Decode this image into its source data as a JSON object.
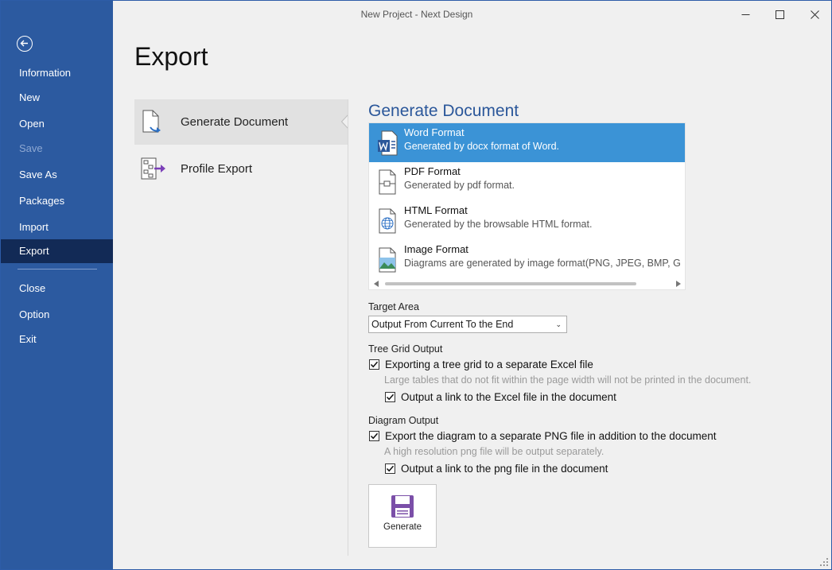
{
  "window": {
    "title": "New Project - Next Design",
    "controls": [
      "minimize-icon",
      "maximize-icon",
      "close-icon"
    ]
  },
  "sidebar": {
    "back_icon": "back-arrow-icon",
    "items": [
      {
        "label": "Information",
        "state": "normal"
      },
      {
        "label": "New",
        "state": "normal"
      },
      {
        "label": "Open",
        "state": "normal"
      },
      {
        "label": "Save",
        "state": "disabled"
      },
      {
        "label": "Save As",
        "state": "normal"
      },
      {
        "label": "Packages",
        "state": "normal"
      },
      {
        "label": "Import",
        "state": "normal"
      },
      {
        "label": "Export",
        "state": "active"
      },
      {
        "label": "Close",
        "state": "normal"
      },
      {
        "label": "Option",
        "state": "normal"
      },
      {
        "label": "Exit",
        "state": "normal"
      }
    ],
    "colors": {
      "background": "#2c5aa0",
      "active": "#122a56"
    }
  },
  "page": {
    "title": "Export"
  },
  "options": [
    {
      "label": "Generate Document",
      "icon": "document-export-icon",
      "selected": true
    },
    {
      "label": "Profile Export",
      "icon": "profile-export-icon",
      "selected": false
    }
  ],
  "panel": {
    "title": "Generate Document",
    "formats": [
      {
        "name": "Word Format",
        "desc": "Generated by docx format of Word.",
        "icon": "word-file-icon",
        "selected": true
      },
      {
        "name": "PDF Format",
        "desc": "Generated by pdf format.",
        "icon": "pdf-file-icon",
        "selected": false
      },
      {
        "name": "HTML Format",
        "desc": "Generated by the browsable HTML format.",
        "icon": "html-globe-icon",
        "selected": false
      },
      {
        "name": "Image Format",
        "desc": "Diagrams are generated by image format(PNG, JPEG, BMP, G",
        "icon": "image-file-icon",
        "selected": false
      }
    ],
    "target_area": {
      "label": "Target Area",
      "value": "Output From Current To the End"
    },
    "tree_grid": {
      "label": "Tree Grid Output",
      "export_label": "Exporting a tree grid to a separate Excel file",
      "export_checked": true,
      "hint": "Large tables that do not fit within the page width will not be printed in the document.",
      "link_label": "Output a link to the Excel file in the document",
      "link_checked": true
    },
    "diagram": {
      "label": "Diagram Output",
      "export_label": "Export the diagram to a separate PNG file in addition to the document",
      "export_checked": true,
      "hint": "A high resolution png file will be output separately.",
      "link_label": "Output a link to the png file in the document",
      "link_checked": true
    },
    "generate_button": {
      "label": "Generate",
      "icon": "save-disk-icon",
      "color": "#7b4fa8"
    },
    "accent": "#3b93d6"
  }
}
